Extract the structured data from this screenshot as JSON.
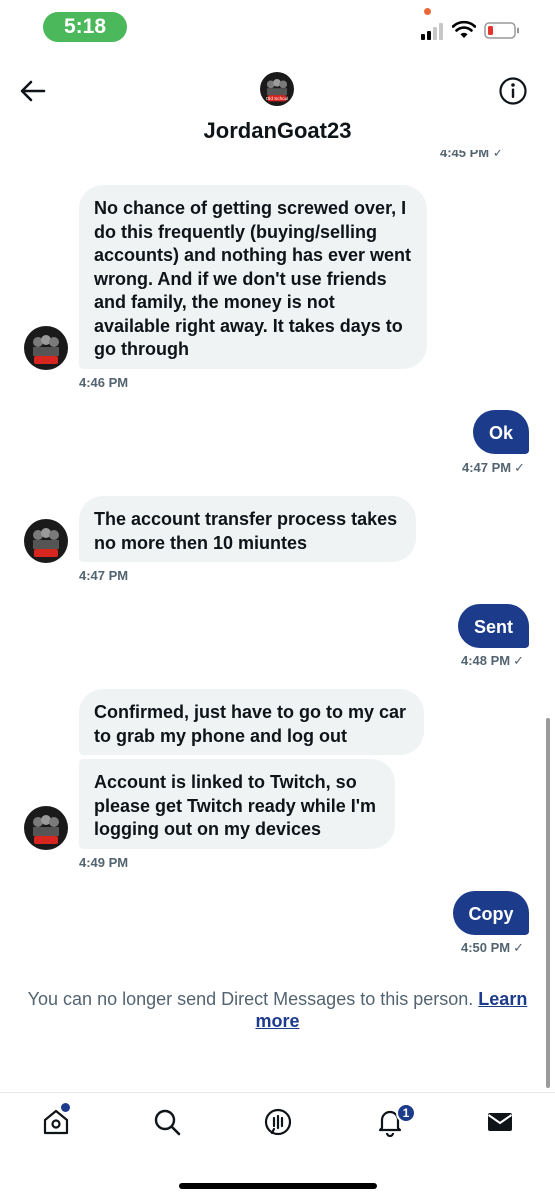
{
  "status_bar": {
    "time": "5:18",
    "accent": "#4cb85c"
  },
  "header": {
    "name": "JordanGoat23",
    "avatar_text": "Old School",
    "back_icon": "arrow-left-icon",
    "info_icon": "info-circle-icon"
  },
  "messages": {
    "partial_timestamp": "4:45 PM ✓",
    "m1": {
      "lines": [
        "No chance of getting screwed over, I",
        "do this frequently (buying/selling",
        "accounts) and nothing has ever went",
        "wrong. And if we don't use friends",
        "and family, the money is not",
        "available right away. It takes days to",
        "go through"
      ],
      "time": "4:46 PM"
    },
    "m2": {
      "text": "Ok",
      "time": "4:47 PM",
      "check": "✓"
    },
    "m3": {
      "lines": [
        "The account transfer process takes",
        "no more then 10 miuntes"
      ],
      "time": "4:47 PM"
    },
    "m4": {
      "text": "Sent",
      "time": "4:48 PM",
      "check": "✓"
    },
    "m5": {
      "lines": [
        "Confirmed, just have to go to my car",
        "to grab my phone and log out"
      ]
    },
    "m6": {
      "lines": [
        "Account is linked to Twitch, so",
        "please get Twitch ready while I'm",
        "logging out on my devices"
      ],
      "time": "4:49 PM"
    },
    "m7": {
      "text": "Copy",
      "time": "4:50 PM",
      "check": "✓"
    }
  },
  "notice": {
    "text": "You can no longer send Direct Messages to this person.",
    "link_part1": "Learn",
    "link_part2": "more"
  },
  "bottom_nav": {
    "items": [
      "home-icon",
      "search-icon",
      "spaces-icon",
      "notifications-icon",
      "messages-icon"
    ],
    "notification_count": "1"
  },
  "colors": {
    "outgoing_bubble": "#1d3b8b",
    "incoming_bubble": "#eff3f4",
    "timestamp": "#536471"
  }
}
